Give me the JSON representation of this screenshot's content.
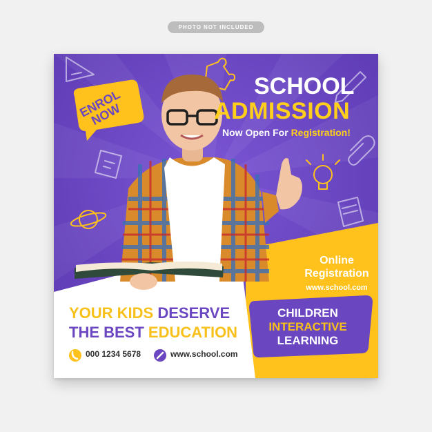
{
  "notice_label": "PHOTO NOT INCLUDED",
  "colors": {
    "purple": "#6a46c1",
    "yellow": "#ffc21c",
    "white": "#ffffff",
    "skin": "#f2c6a4"
  },
  "flyer": {
    "title_line1": "SCHOOL",
    "title_line2": "ADMISSION",
    "subtitle_prefix": "Now Open For ",
    "subtitle_highlight": "Registration!",
    "enrol_badge": "ENROL NOW",
    "online_line1": "Online",
    "online_line2": "Registration",
    "online_url": "www.school.com",
    "headline_line1_a": "YOUR KIDS",
    "headline_line1_b": "DESERVE",
    "headline_line2_a": "THE BEST",
    "headline_line2_b": "EDUCATION",
    "phone": "000 1234 5678",
    "website": "www.school.com",
    "callout_line1": "CHILDREN",
    "callout_line2": "INTERACTIVE",
    "callout_line3": "LEARNING",
    "icons": [
      "triangle-ruler-icon",
      "puzzle-icon",
      "clipboard-icon",
      "paperclip-icon",
      "lightbulb-icon",
      "notebook-icon",
      "planet-icon",
      "pencil-icon",
      "phone-icon",
      "link-icon"
    ]
  }
}
